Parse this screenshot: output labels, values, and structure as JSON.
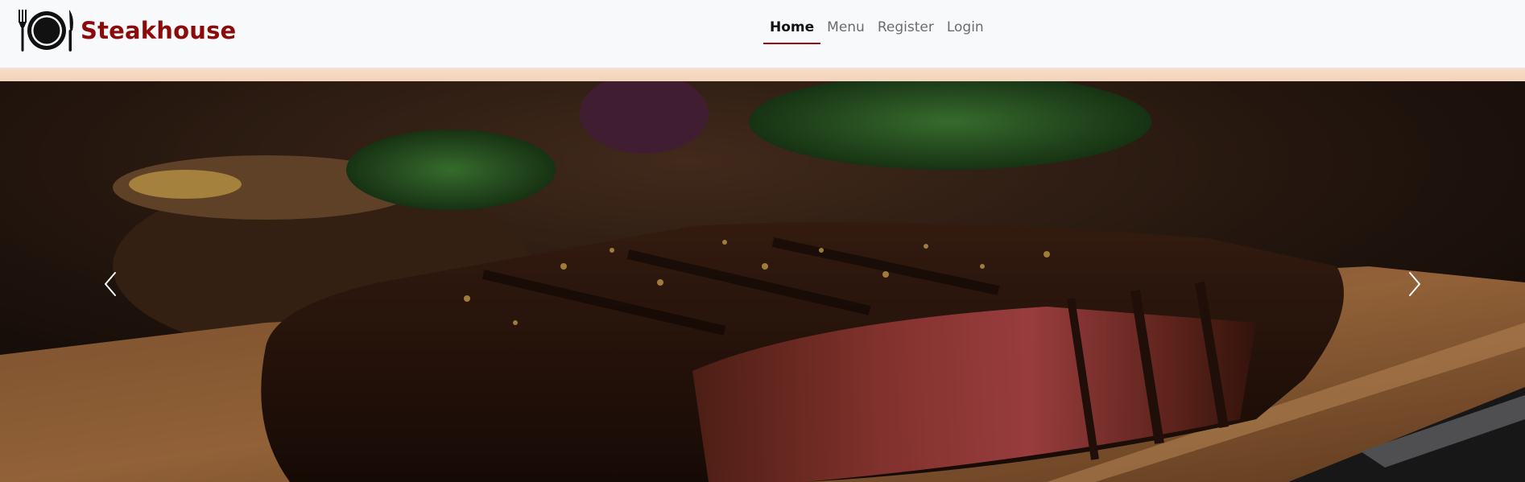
{
  "brand": {
    "name": "Steakhouse",
    "color": "#8b0b0b",
    "logo_icon": "plate-fork-knife-icon"
  },
  "nav": {
    "items": [
      {
        "label": "Home",
        "active": true
      },
      {
        "label": "Menu",
        "active": false
      },
      {
        "label": "Register",
        "active": false
      },
      {
        "label": "Login",
        "active": false
      }
    ],
    "active_underline_color": "#9b0d0d"
  },
  "carousel": {
    "image_subject": "grilled sliced steak on a wooden cutting board",
    "prev_icon": "chevron-left-icon",
    "next_icon": "chevron-right-icon"
  },
  "colors": {
    "navbar_bg": "#f8f9fb",
    "accent_stripe": "#f5d8c1"
  }
}
